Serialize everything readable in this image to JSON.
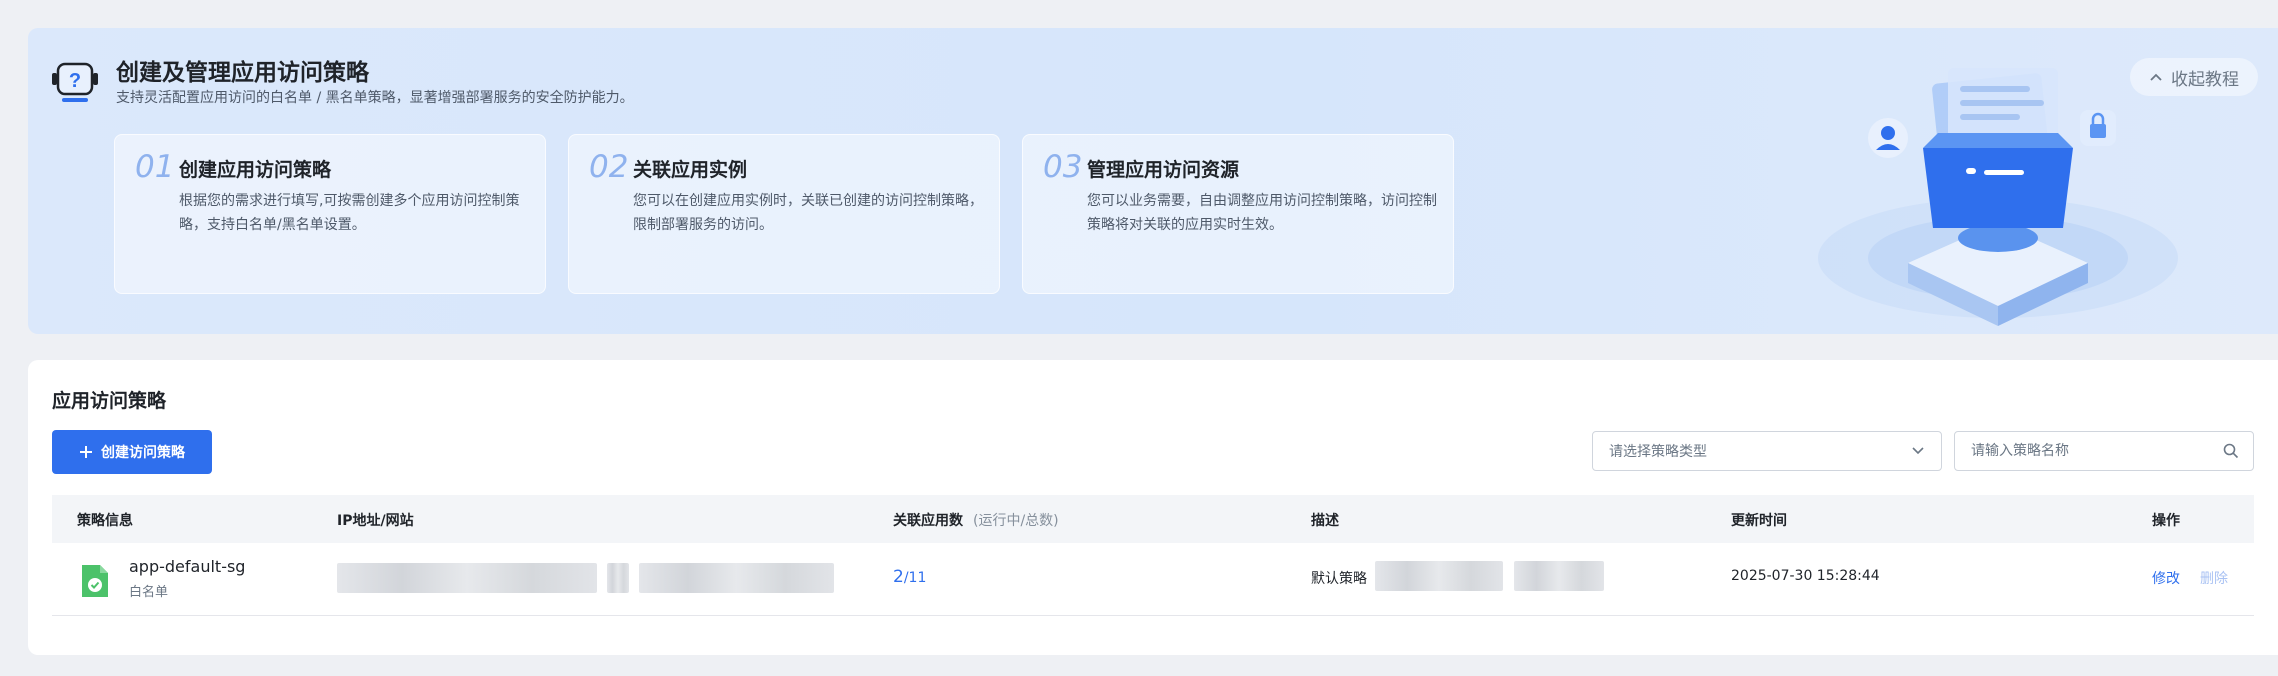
{
  "banner": {
    "title": "创建及管理应用访问策略",
    "subtitle": "支持灵活配置应用访问的白名单 / 黑名单策略，显著增强部署服务的安全防护能力。",
    "collapse_label": "收起教程",
    "steps": [
      {
        "num": "01",
        "title": "创建应用访问策略",
        "desc": "根据您的需求进行填写,可按需创建多个应用访问控制策略，支持白名单/黑名单设置。"
      },
      {
        "num": "02",
        "title": "关联应用实例",
        "desc": "您可以在创建应用实例时，关联已创建的访问控制策略，限制部署服务的访问。"
      },
      {
        "num": "03",
        "title": "管理应用访问资源",
        "desc": "您可以业务需要，自由调整应用访问控制策略，访问控制策略将对关联的应用实时生效。"
      }
    ]
  },
  "panel": {
    "title": "应用访问策略",
    "create_label": "创建访问策略",
    "type_select_placeholder": "请选择策略类型",
    "search_placeholder": "请输入策略名称"
  },
  "table": {
    "headers": {
      "info": "策略信息",
      "ip": "IP地址/网站",
      "count": "关联应用数",
      "count_sub": "(运行中/总数)",
      "desc": "描述",
      "updated": "更新时间",
      "actions": "操作"
    },
    "rows": [
      {
        "name": "app-default-sg",
        "type": "白名单",
        "running": "2",
        "total": "/11",
        "desc": "默认策略",
        "updated": "2025-07-30 15:28:44",
        "edit": "修改",
        "delete": "删除"
      }
    ]
  },
  "colors": {
    "accent": "#2f6fed",
    "banner_bg": "#d6e6fb",
    "file_icon": "#4cc26a"
  }
}
